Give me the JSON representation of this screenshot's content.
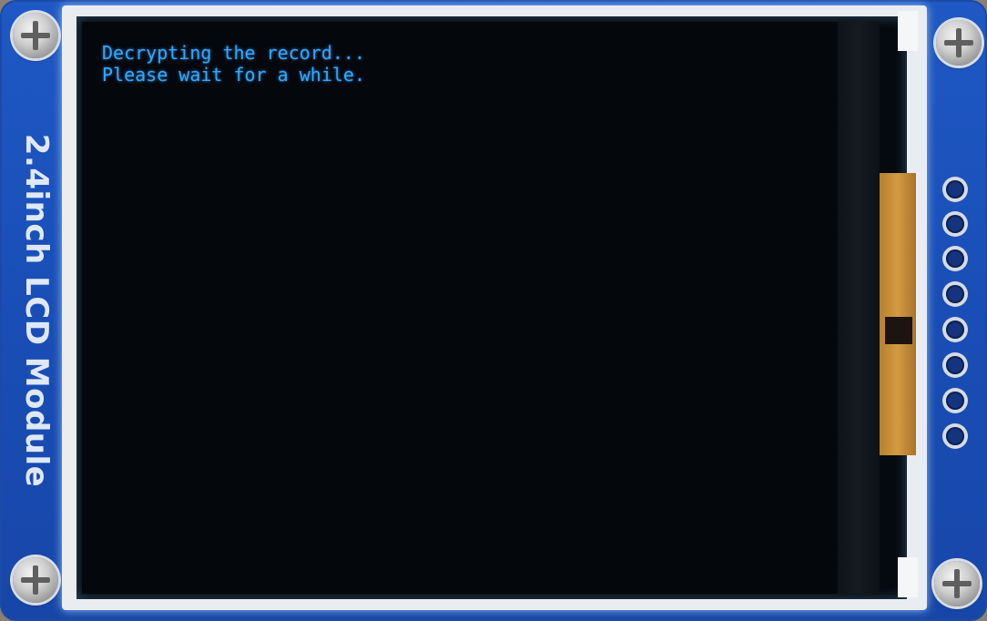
{
  "board": {
    "silkscreen_label": "2.4inch LCD Module",
    "colors": {
      "pcb": "#1a4fb8",
      "frame": "#e9edf1",
      "screen_background": "#04080d",
      "text": "#33a6ff"
    }
  },
  "screen": {
    "lines": [
      "Decrypting the record...",
      "Please wait for a while."
    ]
  },
  "icons": [
    "screw-icon",
    "header-pin-icon"
  ]
}
